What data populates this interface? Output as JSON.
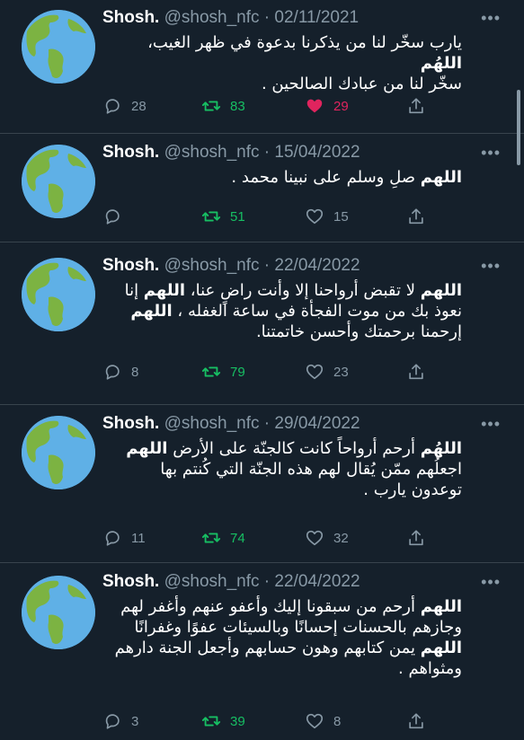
{
  "tweets": [
    {
      "name": "Shosh.",
      "handle": "@shosh_nfc",
      "date": "02/11/2021",
      "lines": [
        [
          {
            "t": "يارب سخّر لنا من يذكرنا بدعوة في ظهر الغيب، ",
            "b": false
          },
          {
            "t": "اللهُم",
            "b": true
          }
        ],
        [
          {
            "t": "سخّر لنا من عبادك الصالحين .",
            "b": false
          }
        ]
      ],
      "replies": "28",
      "retweets": "83",
      "likes": "29",
      "liked": true
    },
    {
      "name": "Shosh.",
      "handle": "@shosh_nfc",
      "date": "15/04/2022",
      "lines": [
        [
          {
            "t": "اللهم",
            "b": true
          },
          {
            "t": " صلِ وسلم على نبينا محمد .",
            "b": false
          }
        ]
      ],
      "replies": "",
      "retweets": "51",
      "likes": "15",
      "liked": false
    },
    {
      "name": "Shosh.",
      "handle": "@shosh_nfc",
      "date": "22/04/2022",
      "lines": [
        [
          {
            "t": "اللهم",
            "b": true
          },
          {
            "t": " لا تقبض أرواحنا إلا وأنت راضٍ عنا، ",
            "b": false
          },
          {
            "t": "اللهم",
            "b": true
          },
          {
            "t": " إنا",
            "b": false
          }
        ],
        [
          {
            "t": "نعوذ بك من موت الفجأة في ساعة الغفله ، ",
            "b": false
          },
          {
            "t": "اللهم",
            "b": true
          }
        ],
        [
          {
            "t": "إرحمنا برحمتك وأحسن خاتمتنا.",
            "b": false
          }
        ]
      ],
      "replies": "8",
      "retweets": "79",
      "likes": "23",
      "liked": false
    },
    {
      "name": "Shosh.",
      "handle": "@shosh_nfc",
      "date": "29/04/2022",
      "lines": [
        [
          {
            "t": "اللهُم",
            "b": true
          },
          {
            "t": "  أرحم أرواحاً كانت كالجنّة على الأرض ",
            "b": false
          },
          {
            "t": "اللهم",
            "b": true
          }
        ],
        [
          {
            "t": "اجعلُهم ممّن يُقال لهم هذه الجنّة التي كُنتم بها",
            "b": false
          }
        ],
        [
          {
            "t": "توعدون يارب .",
            "b": false
          }
        ]
      ],
      "replies": "11",
      "retweets": "74",
      "likes": "32",
      "liked": false
    },
    {
      "name": "Shosh.",
      "handle": "@shosh_nfc",
      "date": "22/04/2022",
      "lines": [
        [
          {
            "t": "اللهم",
            "b": true
          },
          {
            "t": " أرحم من سبقونا إليك وأعفو عنهم وأغفر لهم",
            "b": false
          }
        ],
        [
          {
            "t": "وجازهم بالحسنات إحسانًا وبالسيئات عفوًا وغفرانًا",
            "b": false
          }
        ],
        [
          {
            "t": "اللهم",
            "b": true
          },
          {
            "t": " يمن كتابهم وهون حسابهم وأجعل الجنة دارهم",
            "b": false
          }
        ],
        [
          {
            "t": "ومثواهم .",
            "b": false
          }
        ]
      ],
      "replies": "3",
      "retweets": "39",
      "likes": "8",
      "liked": false
    }
  ],
  "colors": {
    "background": "#15202b",
    "muted": "#8899a6",
    "retweet": "#17bf63",
    "like": "#e0245e",
    "separator": "#38444d"
  },
  "icons": {
    "avatar": "earth-globe-icon",
    "more": "more-dots-icon",
    "reply": "reply-icon",
    "retweet": "retweet-icon",
    "like": "heart-icon",
    "share": "share-icon"
  }
}
